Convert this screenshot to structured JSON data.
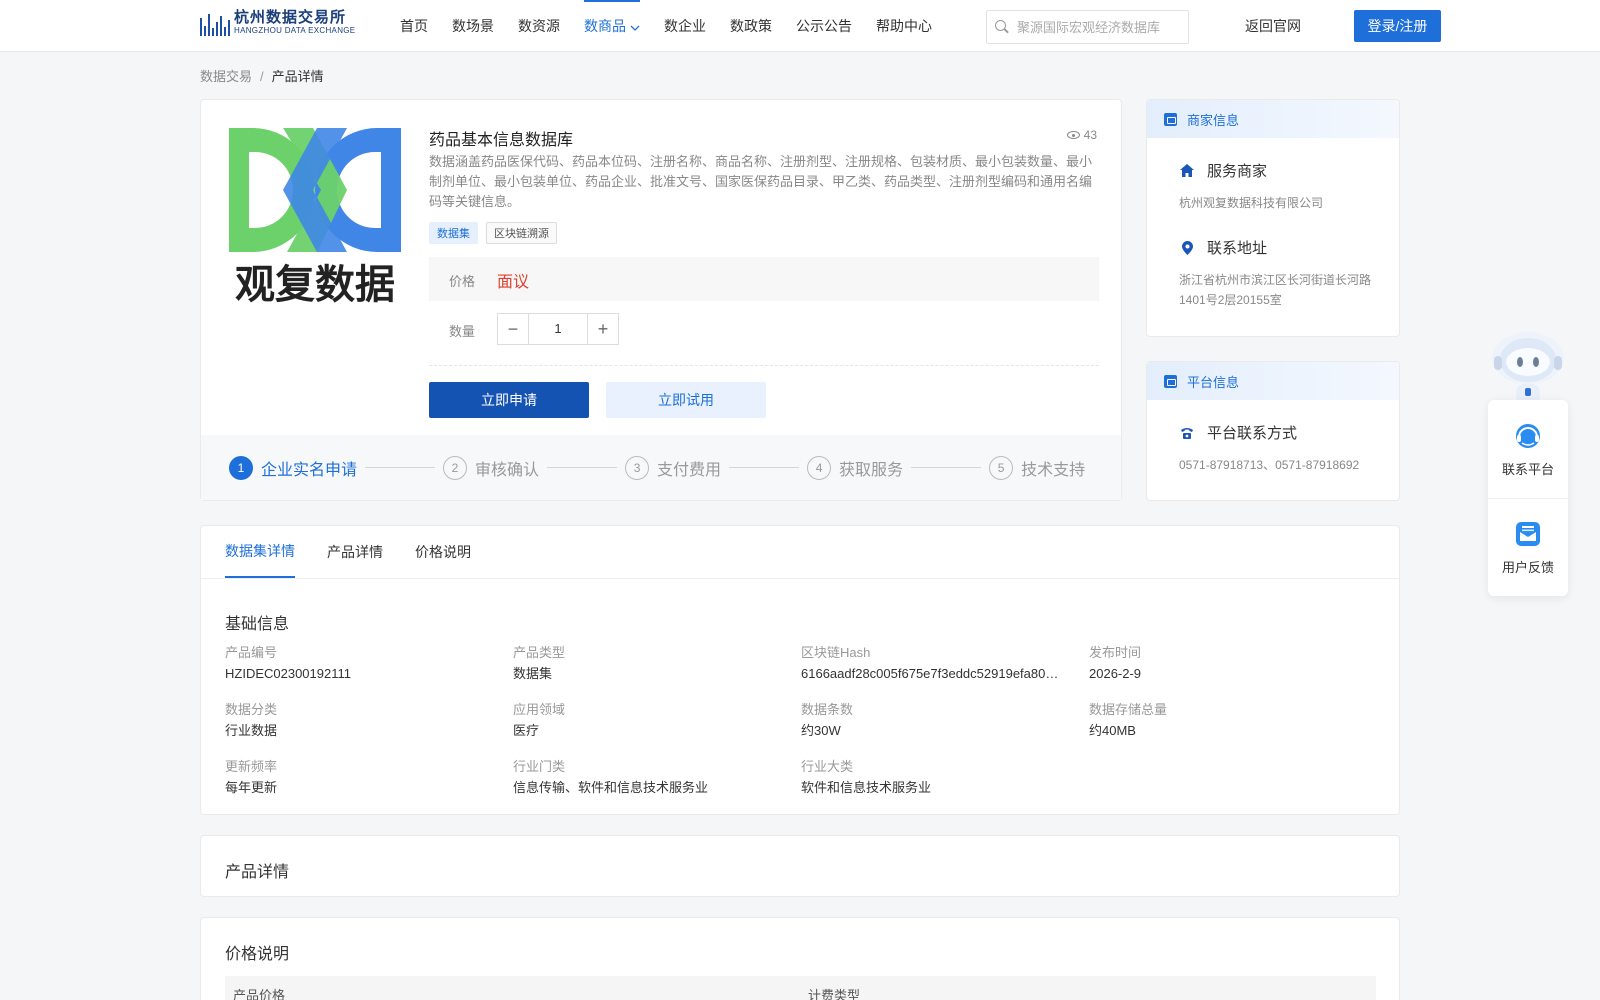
{
  "header": {
    "logo_cn": "杭州数据交易所",
    "logo_en": "HANGZHOU DATA EXCHANGE",
    "nav": [
      {
        "label": "首页",
        "active": false
      },
      {
        "label": "数场景",
        "active": false
      },
      {
        "label": "数资源",
        "active": false
      },
      {
        "label": "数商品",
        "active": true
      },
      {
        "label": "数企业",
        "active": false
      },
      {
        "label": "数政策",
        "active": false
      },
      {
        "label": "公示公告",
        "active": false
      },
      {
        "label": "帮助中心",
        "active": false
      }
    ],
    "search_placeholder": "聚源国际宏观经济数据库",
    "back_link": "返回官网",
    "login_label": "登录/注册"
  },
  "breadcrumb": {
    "parent": "数据交易",
    "separator": "/",
    "current": "产品详情"
  },
  "product": {
    "logo_text": "观复数据",
    "title": "药品基本信息数据库",
    "views": "43",
    "description": "数据涵盖药品医保代码、药品本位码、注册名称、商品名称、注册剂型、注册规格、包装材质、最小包装数量、最小制剂单位、最小包装单位、药品企业、批准文号、国家医保药品目录、甲乙类、药品类型、注册剂型编码和通用名编码等关键信息。",
    "tags": [
      "数据集",
      "区块链溯源"
    ],
    "price_label": "价格",
    "price_value": "面议",
    "qty_label": "数量",
    "qty_value": "1",
    "apply_label": "立即申请",
    "trial_label": "立即试用",
    "steps": [
      {
        "num": "1",
        "label": "企业实名申请",
        "active": true
      },
      {
        "num": "2",
        "label": "审核确认",
        "active": false
      },
      {
        "num": "3",
        "label": "支付费用",
        "active": false
      },
      {
        "num": "4",
        "label": "获取服务",
        "active": false
      },
      {
        "num": "5",
        "label": "技术支持",
        "active": false
      }
    ]
  },
  "merchant": {
    "head": "商家信息",
    "service_title": "服务商家",
    "service_value": "杭州观复数据科技有限公司",
    "address_title": "联系地址",
    "address_value": "浙江省杭州市滨江区长河街道长河路1401号2层20155室"
  },
  "platform": {
    "head": "平台信息",
    "contact_title": "平台联系方式",
    "contact_value": "0571-87918713、0571-87918692"
  },
  "float": {
    "contact_label": "联系平台",
    "feedback_label": "用户反馈"
  },
  "detail": {
    "tabs": [
      {
        "label": "数据集详情",
        "active": true
      },
      {
        "label": "产品详情",
        "active": false
      },
      {
        "label": "价格说明",
        "active": false
      }
    ],
    "basic_title": "基础信息",
    "fields": [
      {
        "label": "产品编号",
        "value": "HZIDEC02300192111"
      },
      {
        "label": "产品类型",
        "value": "数据集"
      },
      {
        "label": "区块链Hash",
        "value": "6166aadf28c005f675e7f3eddc52919efa80…"
      },
      {
        "label": "发布时间",
        "value": "2026-2-9"
      },
      {
        "label": "数据分类",
        "value": "行业数据"
      },
      {
        "label": "应用领域",
        "value": "医疗"
      },
      {
        "label": "数据条数",
        "value": "约30W"
      },
      {
        "label": "数据存储总量",
        "value": "约40MB"
      },
      {
        "label": "更新频率",
        "value": "每年更新"
      },
      {
        "label": "行业门类",
        "value": "信息传输、软件和信息技术服务业"
      },
      {
        "label": "行业大类",
        "value": "软件和信息技术服务业"
      }
    ]
  },
  "product_detail": {
    "title": "产品详情"
  },
  "price_desc": {
    "title": "价格说明",
    "col1": "产品价格",
    "col2": "计费类型"
  },
  "colors": {
    "accent": "#1e6fd9",
    "primary_button": "#1553b2",
    "price": "#e0402d",
    "logo_green": "#6cd16a",
    "logo_blue": "#3f86e6"
  }
}
